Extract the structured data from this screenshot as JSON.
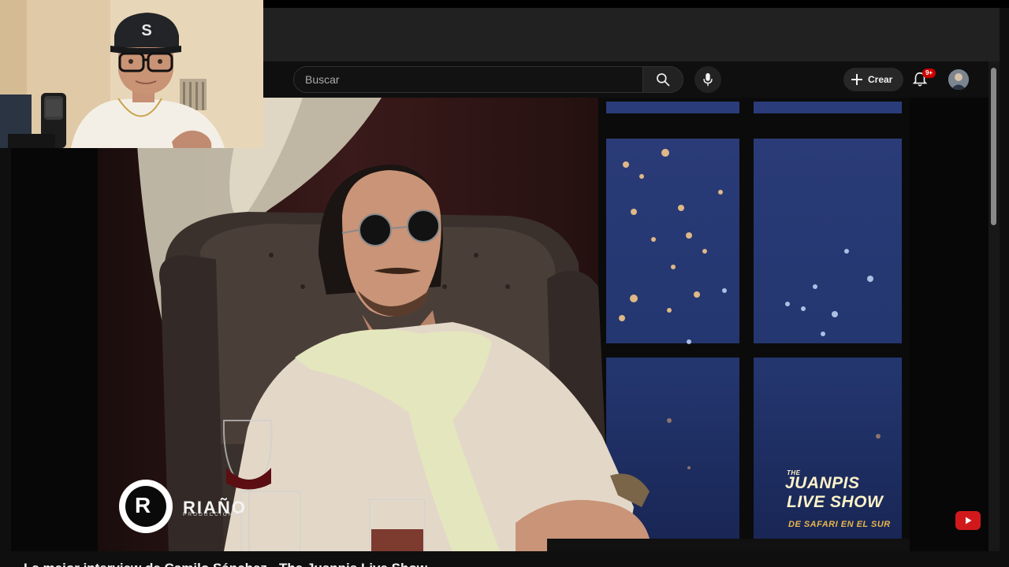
{
  "masthead": {
    "search_placeholder": "Buscar",
    "search_icon": "search-icon",
    "mic_icon": "microphone-icon",
    "create_label": "Crear",
    "create_icon": "plus-icon",
    "notifications_icon": "bell-icon",
    "notification_badge": "9+",
    "accent_color": "#cc0000"
  },
  "video": {
    "production_watermark": "RIAÑO",
    "production_watermark_sub": "PRODUCCIONES",
    "production_logo": "R",
    "show_logo": {
      "line1": "THE",
      "line2": "JUANPIS",
      "line3": "LIVE SHOW",
      "line4": "DE SAFARI EN EL SUR"
    },
    "title": "La mejor interview de Camilo Sánchez - The Juanpis Live Show"
  },
  "webcam": {
    "cap_letter": "S"
  }
}
